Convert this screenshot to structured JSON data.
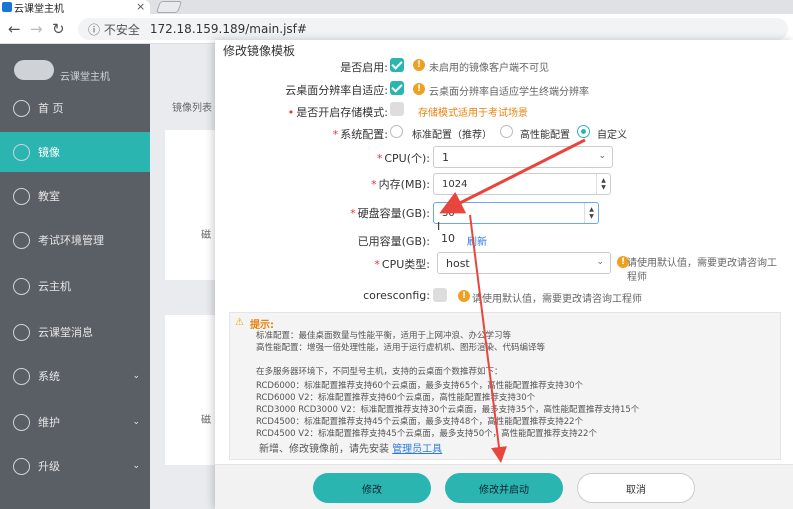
{
  "browser": {
    "tab_title": "云课堂主机",
    "tab_close": "×",
    "insecure_label": "ⓘ 不安全",
    "url": "172.18.159.189/main.jsf#"
  },
  "sidebar": {
    "logo_text": "云课堂主机",
    "items": [
      {
        "label": "首 页",
        "icon": "home-icon",
        "active": false
      },
      {
        "label": "镜像",
        "icon": "image-icon",
        "active": true
      },
      {
        "label": "教室",
        "icon": "classroom-icon",
        "active": false
      },
      {
        "label": "考试环境管理",
        "icon": "exam-icon",
        "active": false
      },
      {
        "label": "云主机",
        "icon": "host-icon",
        "active": false
      },
      {
        "label": "云课堂消息",
        "icon": "message-icon",
        "active": false
      },
      {
        "label": "系统",
        "icon": "system-icon",
        "active": false,
        "chevron": "⌄"
      },
      {
        "label": "维护",
        "icon": "maintenance-icon",
        "active": false,
        "chevron": "⌄"
      },
      {
        "label": "升级",
        "icon": "upgrade-icon",
        "active": false,
        "chevron": "⌄"
      }
    ]
  },
  "background": {
    "list_label": "镜像列表",
    "card_label_1": "磁",
    "card_label_2": "磁"
  },
  "modal": {
    "title": "修改镜像模板",
    "enabled": {
      "label": "是否启用:",
      "hint": "未启用的镜像客户端不可见"
    },
    "adaptive": {
      "label": "云桌面分辨率自适应:",
      "hint": "云桌面分辨率自适应学生终端分辨率"
    },
    "storage_mode": {
      "label": "是否开启存储模式:",
      "hint": "存储模式适用于考试场景"
    },
    "sys_config": {
      "label": "系统配置:",
      "options": [
        "标准配置（推荐）",
        "高性能配置",
        "自定义"
      ],
      "selected": 2
    },
    "cpu": {
      "label": "CPU(个):",
      "value": "1"
    },
    "memory": {
      "label": "内存(MB):",
      "value": "1024"
    },
    "disk": {
      "label": "硬盘容量(GB):",
      "value": "30"
    },
    "used": {
      "label": "已用容量(GB):",
      "value": "10",
      "refresh": "刷新"
    },
    "cpu_type": {
      "label": "CPU类型:",
      "value": "host",
      "hint_1": "请使用默认值，需要更改请咨询工",
      "hint_2": "程师"
    },
    "coresconfig": {
      "label": "coresconfig:",
      "hint": "请使用默认值，需要更改请咨询工程师"
    },
    "tip": {
      "title": "提示:",
      "lines": [
        "标准配置：最佳桌面数量与性能平衡，适用于上网冲浪、办公学习等",
        "高性能配置：增强一倍处理性能，适用于运行虚机机、图形渲染、代码编译等",
        "",
        "在多服务器环境下，不同型号主机，支持的云桌面个数推荐如下：",
        "RCD6000：标准配置推荐支持60个云桌面，最多支持65个，高性能配置推荐支持30个",
        "RCD6000 V2：标准配置推荐支持60个云桌面，高性能配置推荐支持30个",
        "RCD3000 RCD3000 V2：标准配置推荐支持30个云桌面，最多支持35个，高性能配置推荐支持15个",
        "RCD4500：标准配置推荐支持45个云桌面，最多支持48个，高性能配置推荐支持22个",
        "RCD4500 V2：标准配置推荐支持45个云桌面，最多支持50个，高性能配置推荐支持22个"
      ]
    },
    "install_prefix": "新增、修改镜像前，请先安装",
    "install_link": "管理员工具",
    "buttons": {
      "modify": "修改",
      "modify_start": "修改并启动",
      "cancel": "取消"
    }
  },
  "colors": {
    "accent": "#2bb5b0",
    "warn": "#f0a020",
    "arrow": "#e8453c"
  }
}
